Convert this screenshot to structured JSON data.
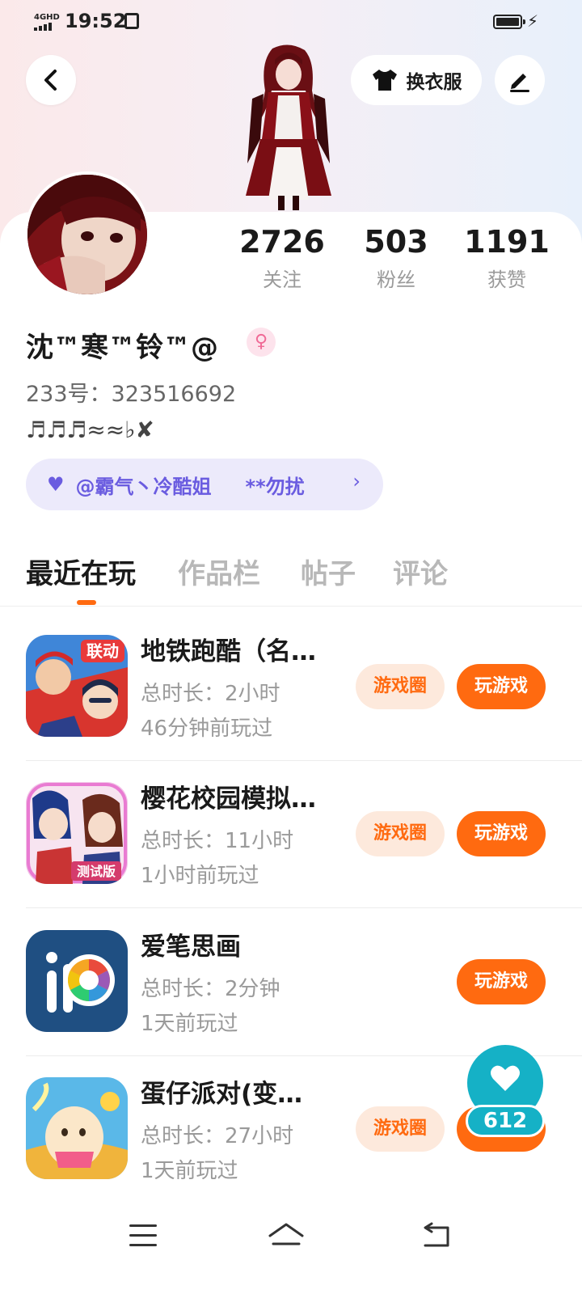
{
  "status_bar": {
    "network": "4GHD",
    "time": "19:52"
  },
  "header": {
    "outfit_label": "换衣服"
  },
  "profile": {
    "stats": [
      {
        "value": "2726",
        "label": "关注"
      },
      {
        "value": "503",
        "label": "粉丝"
      },
      {
        "value": "1191",
        "label": "获赞"
      }
    ],
    "username": "沈™寒™铃™@",
    "gender_symbol": "♀",
    "uid": "233号：323516692",
    "bio": "♬♬♬≈≈♭✘",
    "tag": {
      "name": "@霸气丶冷酷姐",
      "note": "**勿扰",
      "chevron": "›"
    }
  },
  "tabs": [
    {
      "label": "最近在玩",
      "active": true
    },
    {
      "label": "作品栏",
      "active": false
    },
    {
      "label": "帖子",
      "active": false
    },
    {
      "label": "评论",
      "active": false
    }
  ],
  "games": [
    {
      "title": "地铁跑酷（名…",
      "duration": "总时长：2小时",
      "last_played": "46分钟前玩过",
      "circle_label": "游戏圈",
      "play_label": "玩游戏",
      "icon_badge": "联动"
    },
    {
      "title": "樱花校园模拟…",
      "duration": "总时长：11小时",
      "last_played": "1小时前玩过",
      "circle_label": "游戏圈",
      "play_label": "玩游戏",
      "icon_badge": "测试版"
    },
    {
      "title": "爱笔思画",
      "duration": "总时长：2分钟",
      "last_played": "1天前玩过",
      "circle_label": "",
      "play_label": "玩游戏"
    },
    {
      "title": "蛋仔派对(变…",
      "duration": "总时长：27小时",
      "last_played": "1天前玩过",
      "circle_label": "游戏圈",
      "play_label": "玩游戏"
    }
  ],
  "like_fab": {
    "count": "612"
  },
  "colors": {
    "accent": "#ff6a10",
    "tag_text": "#6a5ce0",
    "fab": "#15b1c6"
  },
  "icons": [
    "back-arrow-icon",
    "tshirt-icon",
    "edit-pen-icon",
    "heart-icon",
    "menu-icon",
    "home-icon",
    "back-nav-icon"
  ]
}
